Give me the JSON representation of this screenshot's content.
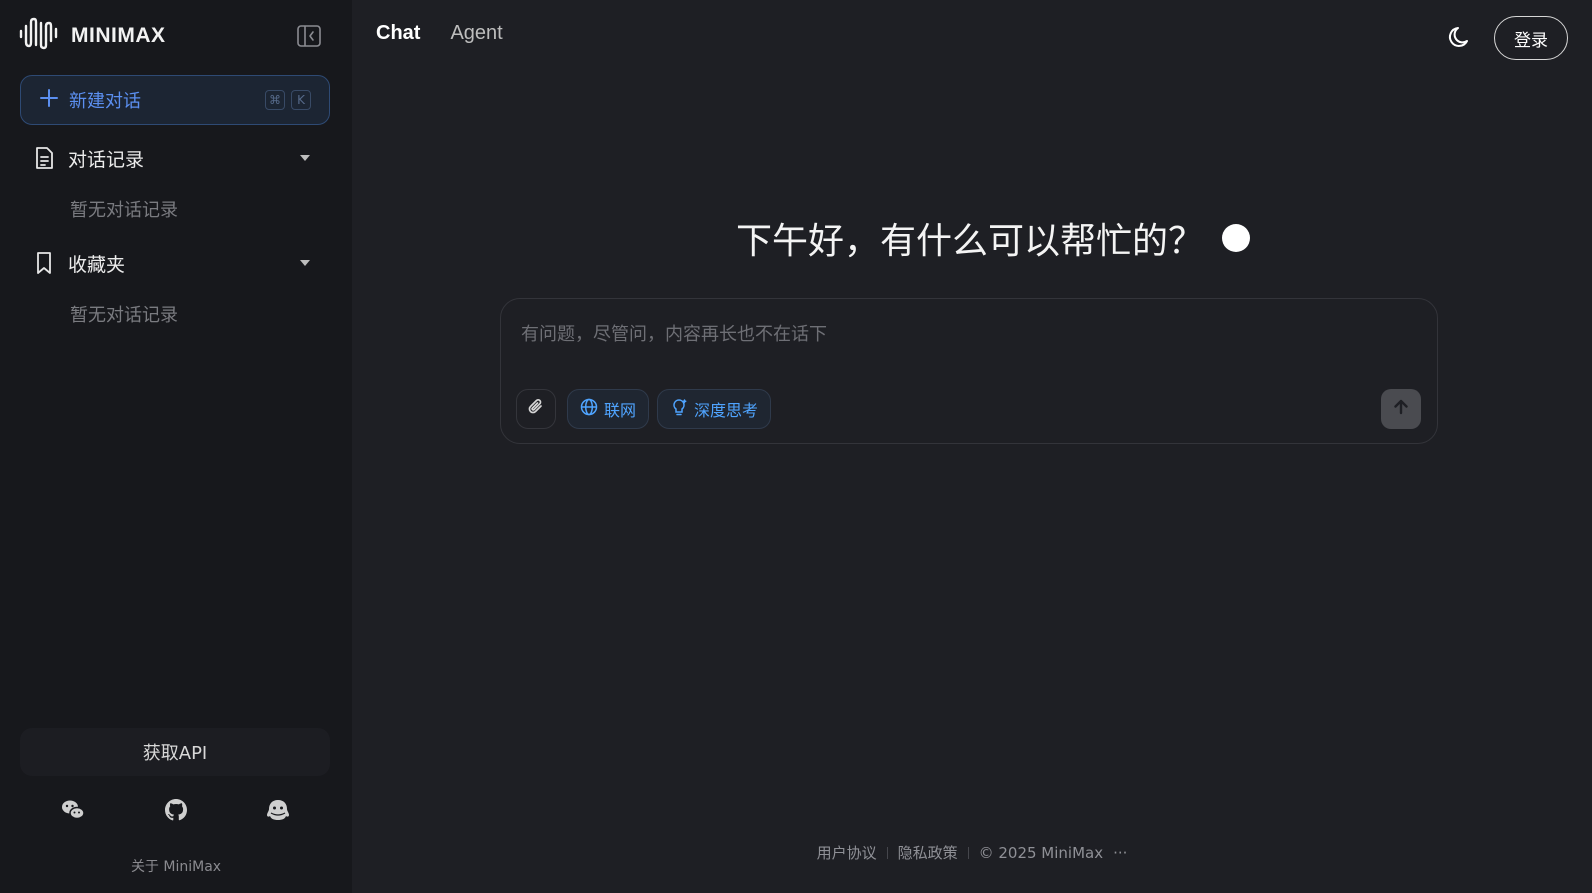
{
  "brand": {
    "name": "MINIMAX",
    "logo_icon": "waveform-logo-icon"
  },
  "sidebar": {
    "new_chat": {
      "label": "新建对话",
      "shortcut_mod": "⌘",
      "shortcut_key": "K"
    },
    "history": {
      "label": "对话记录",
      "empty_text": "暂无对话记录"
    },
    "favorites": {
      "label": "收藏夹",
      "empty_text": "暂无对话记录"
    },
    "get_api": "获取API",
    "social_icons": [
      "wechat-icon",
      "github-icon",
      "community-icon"
    ],
    "about": "关于 MiniMax"
  },
  "header": {
    "tabs": [
      {
        "label": "Chat",
        "active": true
      },
      {
        "label": "Agent",
        "active": false
      }
    ],
    "theme_icon": "moon-icon",
    "login": "登录"
  },
  "main": {
    "greeting": "下午好，有什么可以帮忙的？",
    "composer": {
      "placeholder": "有问题，尽管问，内容再长也不在话下",
      "web_search": "联网",
      "deep_think": "深度思考"
    }
  },
  "footer": {
    "terms": "用户协议",
    "privacy": "隐私政策",
    "copyright": "© 2025 MiniMax",
    "more": "···"
  },
  "colors": {
    "accent": "#5b8ff0",
    "tool_accent": "#4fa4ff",
    "background": "#1e1f24",
    "sidebar_bg": "#17181c"
  }
}
